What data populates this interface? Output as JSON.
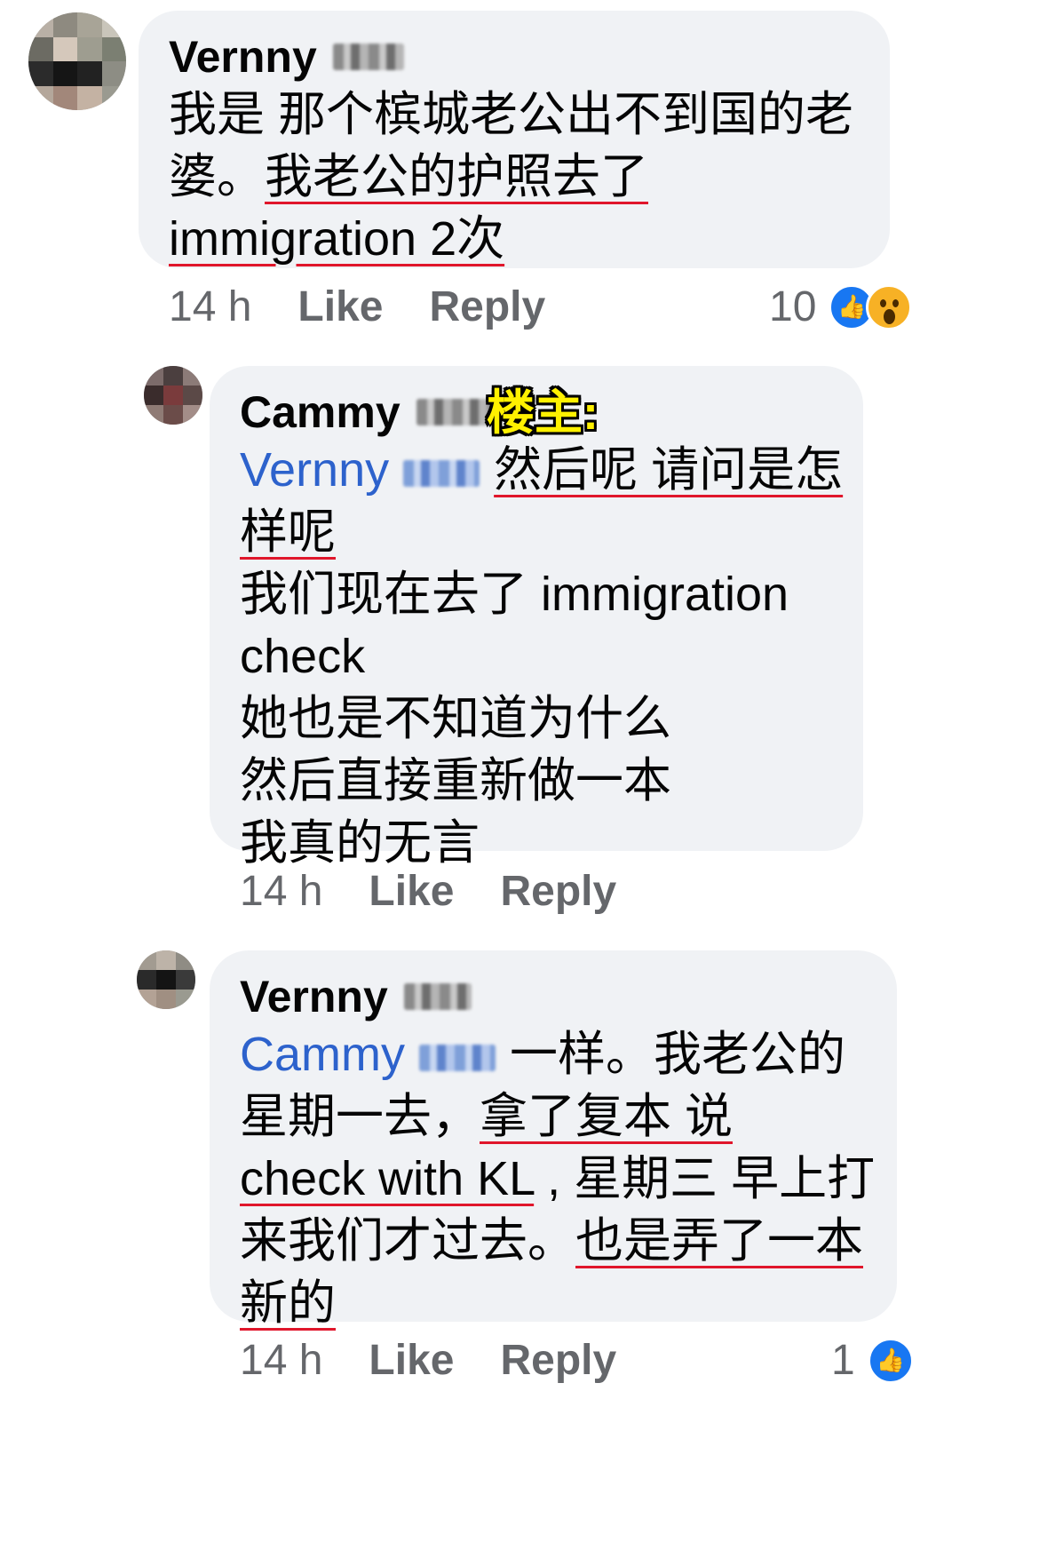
{
  "comments": [
    {
      "author_first": "Vernny",
      "lines": [
        [
          {
            "t": "我是 那个槟城老公出不到国的老"
          }
        ],
        [
          {
            "t": "婆。"
          },
          {
            "t": "我老公的护照去了",
            "u": true
          }
        ],
        [
          {
            "t": "immigration 2次",
            "u": true
          }
        ]
      ],
      "time": "14 h",
      "like_label": "Like",
      "reply_label": "Reply",
      "reaction_count": "10",
      "reactions": [
        "like-icon",
        "wow-icon"
      ]
    },
    {
      "author_first": "Cammy",
      "op_tag": "楼主:",
      "lines": [
        [
          {
            "t": "Vernny",
            "m": true
          },
          {
            "blur": true
          },
          {
            "t": "然后呢 请问是怎",
            "u": true
          }
        ],
        [
          {
            "t": "样呢",
            "u": true
          }
        ],
        [
          {
            "t": "我们现在去了 immigration"
          }
        ],
        [
          {
            "t": "check"
          }
        ],
        [
          {
            "t": "她也是不知道为什么"
          }
        ],
        [
          {
            "t": "然后直接重新做一本"
          }
        ],
        [
          {
            "t": "我真的无言"
          }
        ]
      ],
      "time": "14 h",
      "like_label": "Like",
      "reply_label": "Reply"
    },
    {
      "author_first": "Vernny",
      "lines": [
        [
          {
            "t": "Cammy",
            "m": true
          },
          {
            "blur": true
          },
          {
            "t": "一样。我老公的"
          }
        ],
        [
          {
            "t": "星期一去，"
          },
          {
            "t": "拿了复本 说",
            "u": true
          }
        ],
        [
          {
            "t": "check with KL",
            "u": true
          },
          {
            "t": " , 星期三 早上打"
          }
        ],
        [
          {
            "t": "来我们才过去。"
          },
          {
            "t": "也是弄了一本",
            "u": true
          }
        ],
        [
          {
            "t": "新的",
            "u": true
          }
        ]
      ],
      "time": "14 h",
      "like_label": "Like",
      "reply_label": "Reply",
      "reaction_count": "1",
      "reactions": [
        "like-icon"
      ]
    }
  ]
}
